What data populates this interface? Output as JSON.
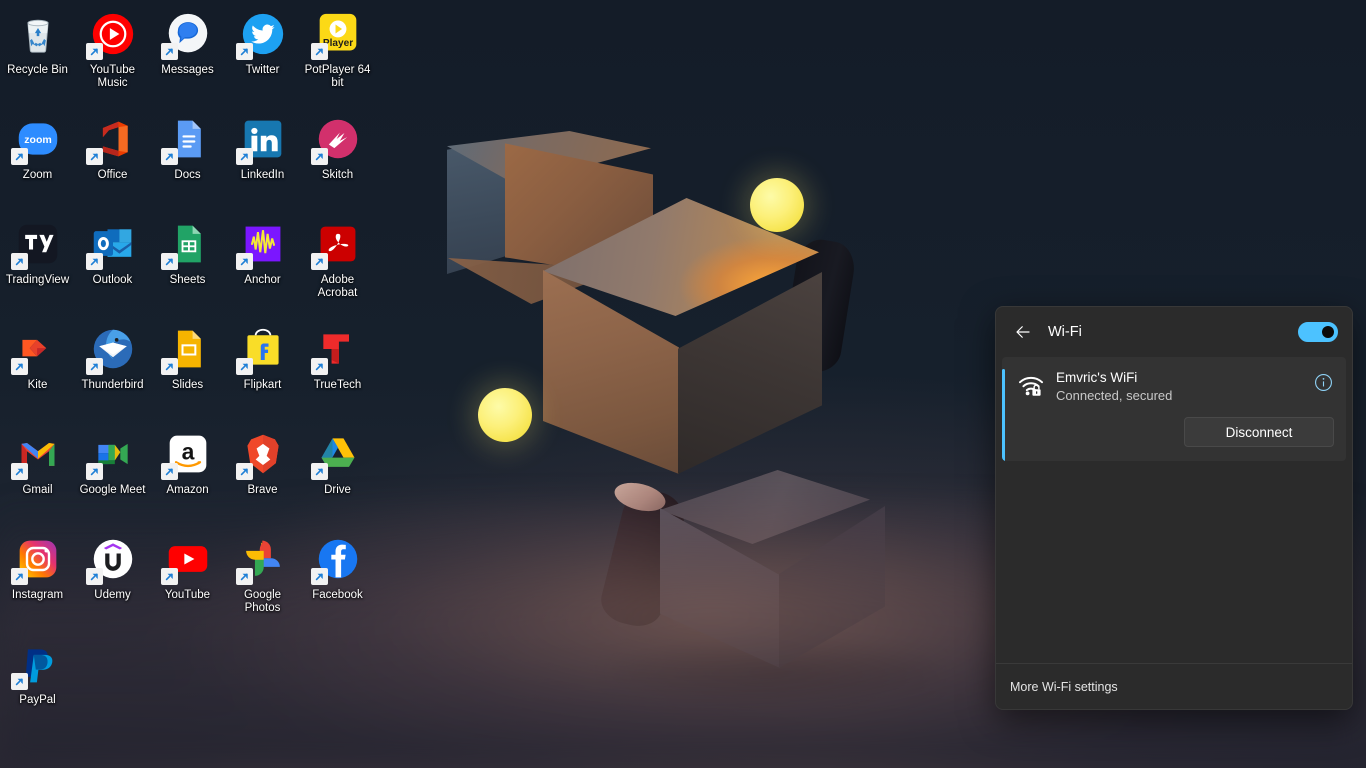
{
  "desktop": {
    "wallpaper": {
      "description": "abstract 3D render with floating cubes, cylinders and glowing yellow spheres",
      "background_color": "#151d29",
      "accent_glow_color": "#f6e44f"
    },
    "icons": [
      {
        "label": "Recycle Bin",
        "icon": "recycle-bin-icon",
        "shortcut": false
      },
      {
        "label": "YouTube Music",
        "icon": "youtube-music-icon",
        "shortcut": true
      },
      {
        "label": "Messages",
        "icon": "messages-icon",
        "shortcut": true
      },
      {
        "label": "Twitter",
        "icon": "twitter-icon",
        "shortcut": true
      },
      {
        "label": "PotPlayer 64 bit",
        "icon": "potplayer-icon",
        "shortcut": true
      },
      {
        "label": "Zoom",
        "icon": "zoom-icon",
        "shortcut": true
      },
      {
        "label": "Office",
        "icon": "office-icon",
        "shortcut": true
      },
      {
        "label": "Docs",
        "icon": "google-docs-icon",
        "shortcut": true
      },
      {
        "label": "LinkedIn",
        "icon": "linkedin-icon",
        "shortcut": true
      },
      {
        "label": "Skitch",
        "icon": "skitch-icon",
        "shortcut": true
      },
      {
        "label": "TradingView",
        "icon": "tradingview-icon",
        "shortcut": true
      },
      {
        "label": "Outlook",
        "icon": "outlook-icon",
        "shortcut": true
      },
      {
        "label": "Sheets",
        "icon": "google-sheets-icon",
        "shortcut": true
      },
      {
        "label": "Anchor",
        "icon": "anchor-icon",
        "shortcut": true
      },
      {
        "label": "Adobe Acrobat",
        "icon": "adobe-acrobat-icon",
        "shortcut": true
      },
      {
        "label": "Kite",
        "icon": "kite-icon",
        "shortcut": true
      },
      {
        "label": "Thunderbird",
        "icon": "thunderbird-icon",
        "shortcut": true
      },
      {
        "label": "Slides",
        "icon": "google-slides-icon",
        "shortcut": true
      },
      {
        "label": "Flipkart",
        "icon": "flipkart-icon",
        "shortcut": true
      },
      {
        "label": "TrueTech",
        "icon": "truetech-icon",
        "shortcut": true
      },
      {
        "label": "Gmail",
        "icon": "gmail-icon",
        "shortcut": true
      },
      {
        "label": "Google Meet",
        "icon": "google-meet-icon",
        "shortcut": true
      },
      {
        "label": "Amazon",
        "icon": "amazon-icon",
        "shortcut": true
      },
      {
        "label": "Brave",
        "icon": "brave-icon",
        "shortcut": true
      },
      {
        "label": "Drive",
        "icon": "google-drive-icon",
        "shortcut": true
      },
      {
        "label": "Instagram",
        "icon": "instagram-icon",
        "shortcut": true
      },
      {
        "label": "Udemy",
        "icon": "udemy-icon",
        "shortcut": true
      },
      {
        "label": "YouTube",
        "icon": "youtube-icon",
        "shortcut": true
      },
      {
        "label": "Google Photos",
        "icon": "google-photos-icon",
        "shortcut": true
      },
      {
        "label": "Facebook",
        "icon": "facebook-icon",
        "shortcut": true
      },
      {
        "label": "PayPal",
        "icon": "paypal-icon",
        "shortcut": true
      }
    ]
  },
  "wifi_panel": {
    "back_icon": "back-arrow-icon",
    "title": "Wi-Fi",
    "toggle": {
      "state": "on",
      "accent_color": "#4cc2ff"
    },
    "network": {
      "icon": "wifi-secured-icon",
      "name": "Emvric's WiFi",
      "status": "Connected, secured",
      "info_icon": "info-icon",
      "action_label": "Disconnect",
      "selected": true,
      "accent_color": "#4cc2ff"
    },
    "footer_link": "More Wi-Fi settings",
    "panel_background": "#2b2b2b"
  }
}
